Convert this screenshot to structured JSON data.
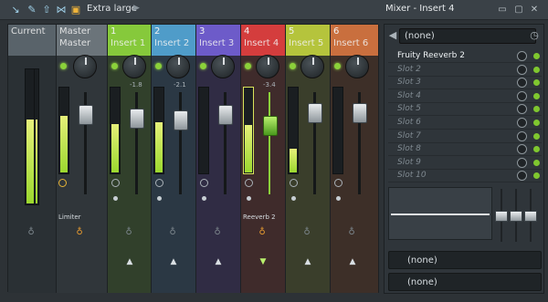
{
  "toolbar": {
    "size_label": "Extra large"
  },
  "title": "Mixer - Insert 4",
  "strips": [
    {
      "num": "",
      "name": "Current",
      "color": "#59636a"
    },
    {
      "num": "",
      "name": "Master",
      "color": "#7b858b"
    },
    {
      "num": "1",
      "name": "Insert 1",
      "color": "#86c93b"
    },
    {
      "num": "2",
      "name": "Insert 2",
      "color": "#4f9cc9"
    },
    {
      "num": "3",
      "name": "Insert 3",
      "color": "#6d5bc9"
    },
    {
      "num": "4",
      "name": "Insert 4",
      "color": "#d43d3d"
    },
    {
      "num": "5",
      "name": "Insert 5",
      "color": "#b5c43c"
    },
    {
      "num": "6",
      "name": "Insert 6",
      "color": "#c96f3e"
    }
  ],
  "master_name": "Master",
  "pan_values": [
    "-1.8",
    "-2.1",
    "-3.4"
  ],
  "route_labels": {
    "master": "Limiter",
    "insert4": "Reeverb 2"
  },
  "panel": {
    "preset": "(none)",
    "slots": [
      "Fruity Reeverb 2",
      "Slot 2",
      "Slot 3",
      "Slot 4",
      "Slot 5",
      "Slot 6",
      "Slot 7",
      "Slot 8",
      "Slot 9",
      "Slot 10"
    ],
    "send1": "(none)",
    "send2": "(none)"
  },
  "meter_levels": {
    "current": 0.62,
    "master": 0.66,
    "insert1": 0.56,
    "insert2": 0.58,
    "insert4": 0.55,
    "insert5": 0.28
  }
}
